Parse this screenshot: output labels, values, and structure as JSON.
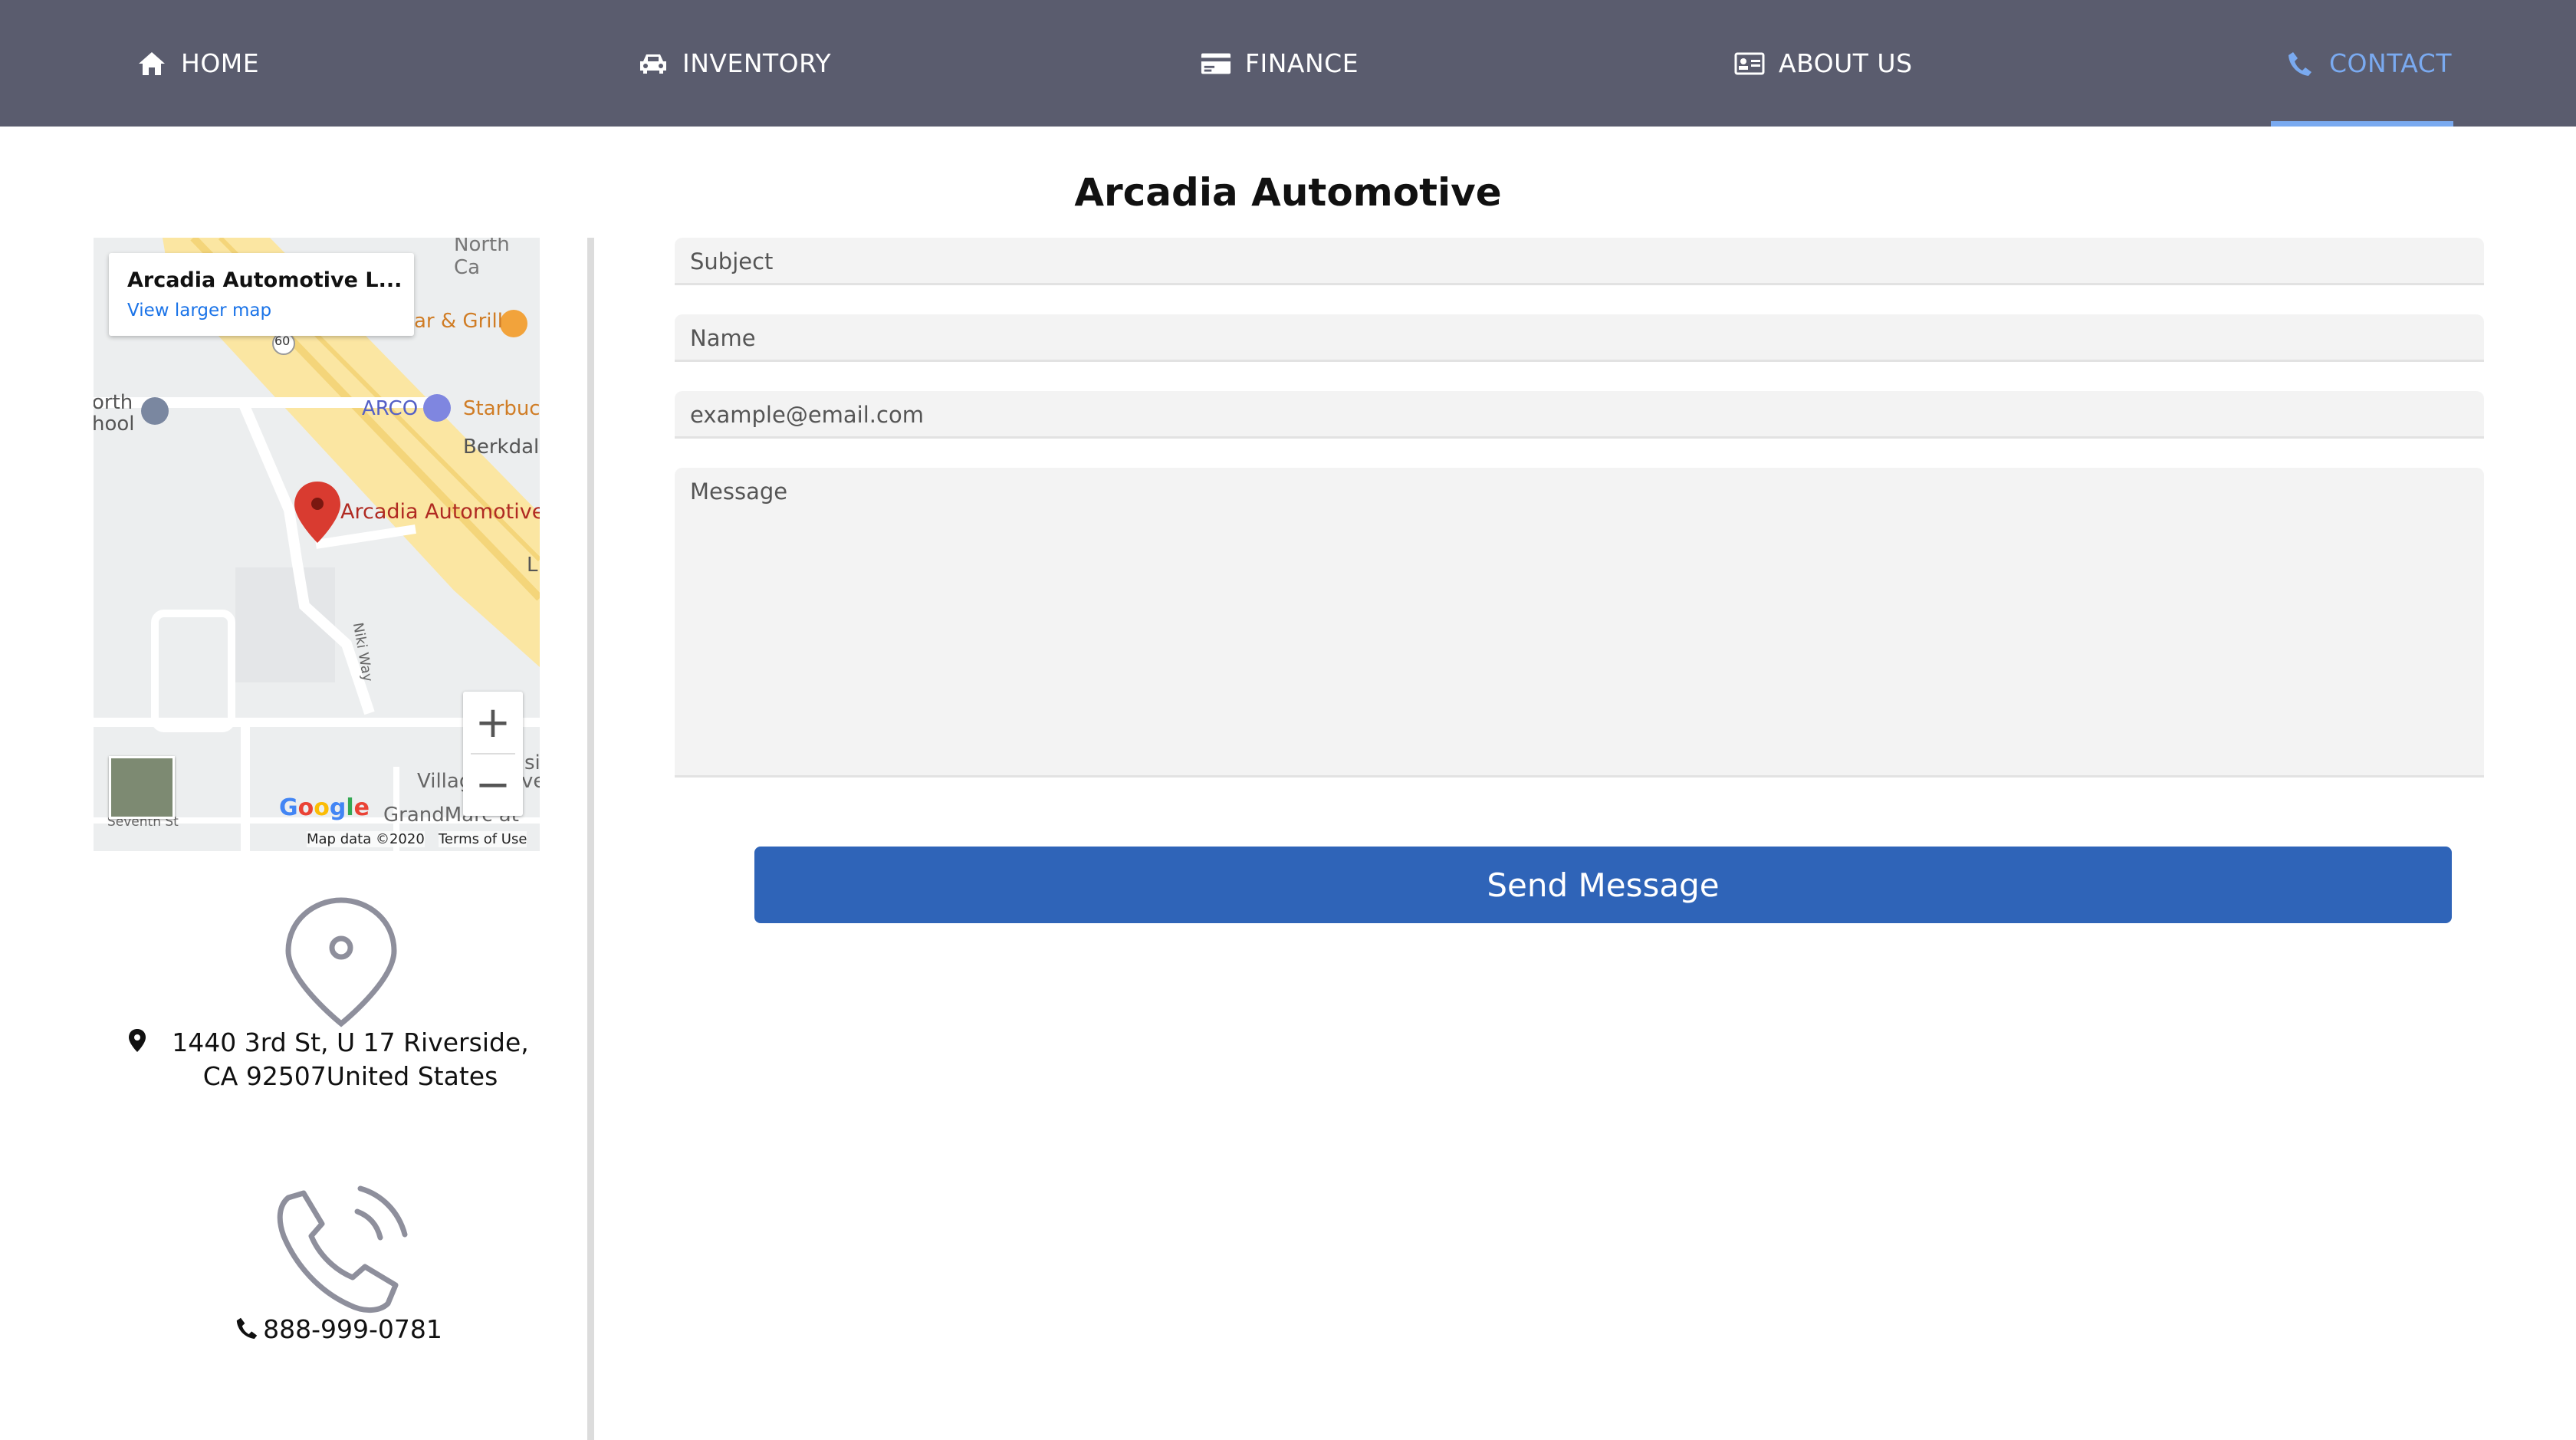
{
  "nav": {
    "items": [
      {
        "label": "HOME",
        "icon": "home-icon"
      },
      {
        "label": "INVENTORY",
        "icon": "car-icon"
      },
      {
        "label": "FINANCE",
        "icon": "credit-card-icon"
      },
      {
        "label": "ABOUT US",
        "icon": "id-card-icon"
      },
      {
        "label": "CONTACT",
        "icon": "phone-icon"
      }
    ],
    "active": "CONTACT"
  },
  "page": {
    "title": "Arcadia Automotive"
  },
  "map": {
    "place_title": "Arcadia Automotive L...",
    "larger_map_link": "View larger map",
    "marker_label": "Arcadia Automotive L",
    "labels": [
      "North Ca",
      "ar & Grill",
      "orth",
      "hool",
      "ARCO",
      "Starbuc",
      "Berkdale",
      "L",
      "Niki Way",
      "Villag",
      "ve",
      "GrandMarc at",
      "si",
      "Seventh St",
      "60"
    ],
    "google": "Google",
    "map_data": "Map data ©2020",
    "terms": "Terms of Use",
    "zoom_in": "+",
    "zoom_out": "−"
  },
  "contact": {
    "address": "1440 3rd St, U 17 Riverside, CA 92507United States",
    "phone": "888-999-0781"
  },
  "form": {
    "subject_placeholder": "Subject",
    "name_placeholder": "Name",
    "email_placeholder": "example@email.com",
    "message_placeholder": "Message",
    "send_label": "Send Message"
  },
  "colors": {
    "nav_bg": "#5a5c6e",
    "nav_active": "#7aaaf0",
    "button": "#2f64b8",
    "field_bg": "#f3f3f3"
  }
}
